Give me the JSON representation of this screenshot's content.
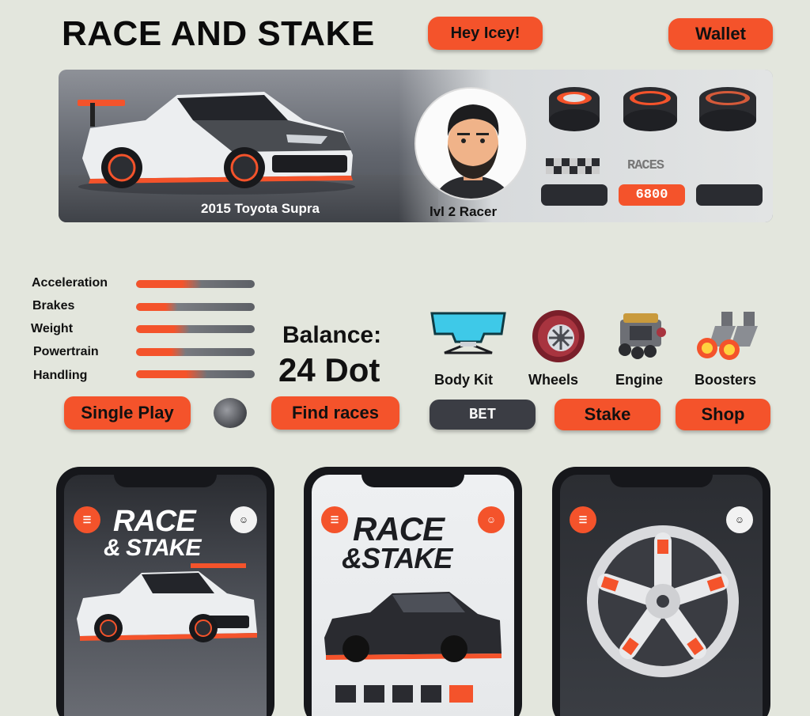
{
  "header": {
    "title": "RACE AND STAKE",
    "greeting_button": "Hey Icey!",
    "wallet_button": "Wallet"
  },
  "profile": {
    "car_name": "2015 Toyota Supra",
    "level": "lvl 2 Racer",
    "stats": [
      {
        "label": "",
        "value": ""
      },
      {
        "label": "RACES",
        "value": "6800"
      },
      {
        "label": "",
        "value": ""
      }
    ]
  },
  "attributes": [
    {
      "label": "Acceleration",
      "level": 0.55
    },
    {
      "label": "Brakes",
      "level": 0.35
    },
    {
      "label": "Weight",
      "level": 0.45
    },
    {
      "label": "Powertrain",
      "level": 0.42
    },
    {
      "label": "Handling",
      "level": 0.6
    }
  ],
  "balance": {
    "label": "Balance:",
    "value": "24 Dot"
  },
  "shop": {
    "items": [
      {
        "label": "Body Kit",
        "icon": "body-kit-icon"
      },
      {
        "label": "Wheels",
        "icon": "wheel-icon"
      },
      {
        "label": "Engine",
        "icon": "engine-icon"
      },
      {
        "label": "Boosters",
        "icon": "booster-icon"
      }
    ]
  },
  "actions": {
    "single_play": "Single Play",
    "find_races": "Find races",
    "bet": "BET",
    "stake": "Stake",
    "shop": "Shop"
  },
  "previews": {
    "phone1_logo_line1": "RACE",
    "phone1_logo_line2": "& STAKE",
    "phone2_logo_line1": "RACE",
    "phone2_logo_line2": "&STAKE"
  },
  "colors": {
    "accent": "#f4532b",
    "dark": "#2a2c31",
    "background": "#e3e6dd"
  }
}
